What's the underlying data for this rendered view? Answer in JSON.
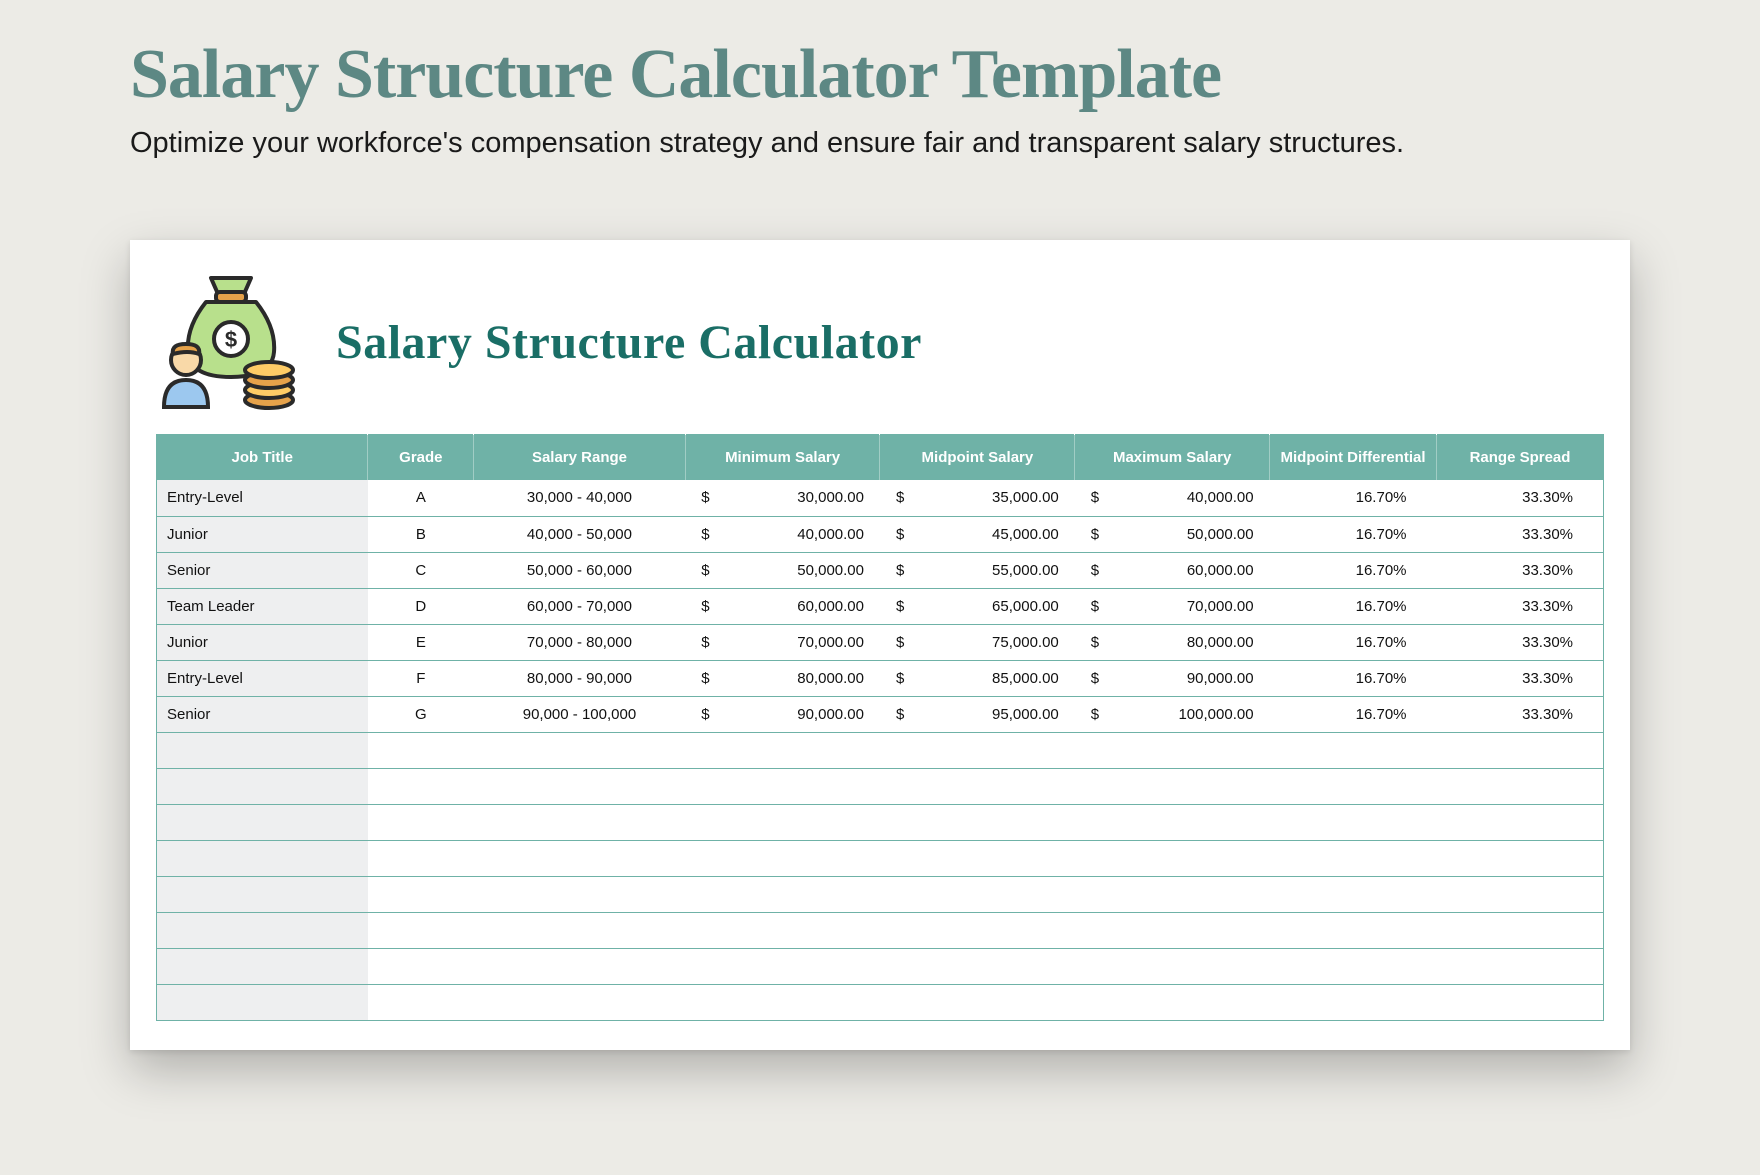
{
  "header": {
    "title": "Salary Structure Calculator Template",
    "subtitle": "Optimize your workforce's compensation strategy and ensure fair and transparent salary structures."
  },
  "card": {
    "title": "Salary Structure Calculator",
    "icon": "money-bag-person-icon"
  },
  "currency_symbol": "$",
  "columns": [
    "Job Title",
    "Grade",
    "Salary Range",
    "Minimum Salary",
    "Midpoint Salary",
    "Maximum Salary",
    "Midpoint Differential",
    "Range Spread"
  ],
  "rows": [
    {
      "job": "Entry-Level",
      "grade": "A",
      "range": "30,000 - 40,000",
      "min": "30,000.00",
      "mid": "35,000.00",
      "max": "40,000.00",
      "diff": "16.70%",
      "spread": "33.30%"
    },
    {
      "job": "Junior",
      "grade": "B",
      "range": "40,000 - 50,000",
      "min": "40,000.00",
      "mid": "45,000.00",
      "max": "50,000.00",
      "diff": "16.70%",
      "spread": "33.30%"
    },
    {
      "job": "Senior",
      "grade": "C",
      "range": "50,000 - 60,000",
      "min": "50,000.00",
      "mid": "55,000.00",
      "max": "60,000.00",
      "diff": "16.70%",
      "spread": "33.30%"
    },
    {
      "job": "Team Leader",
      "grade": "D",
      "range": "60,000 - 70,000",
      "min": "60,000.00",
      "mid": "65,000.00",
      "max": "70,000.00",
      "diff": "16.70%",
      "spread": "33.30%"
    },
    {
      "job": "Junior",
      "grade": "E",
      "range": "70,000 - 80,000",
      "min": "70,000.00",
      "mid": "75,000.00",
      "max": "80,000.00",
      "diff": "16.70%",
      "spread": "33.30%"
    },
    {
      "job": "Entry-Level",
      "grade": "F",
      "range": "80,000 - 90,000",
      "min": "80,000.00",
      "mid": "85,000.00",
      "max": "90,000.00",
      "diff": "16.70%",
      "spread": "33.30%"
    },
    {
      "job": "Senior",
      "grade": "G",
      "range": "90,000 - 100,000",
      "min": "90,000.00",
      "mid": "95,000.00",
      "max": "100,000.00",
      "diff": "16.70%",
      "spread": "33.30%"
    }
  ],
  "empty_rows": 8
}
